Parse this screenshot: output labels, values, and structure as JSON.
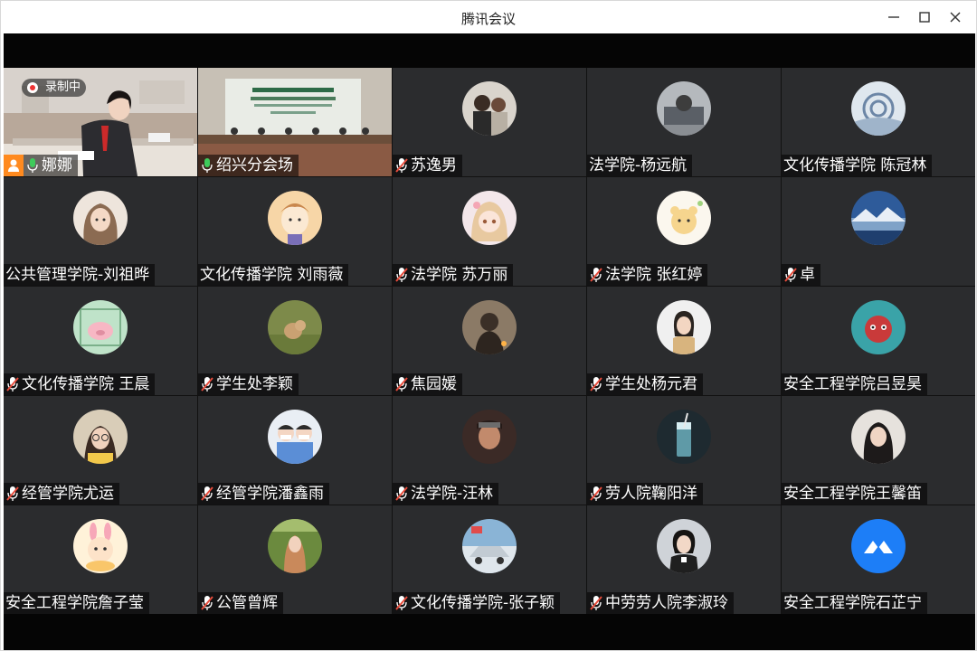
{
  "window": {
    "title": "腾讯会议",
    "controls": [
      "minimize",
      "maximize",
      "close"
    ]
  },
  "recording": {
    "label": "录制中"
  },
  "participants": [
    {
      "name": "娜娜",
      "mic": "on",
      "video": "speaker",
      "host": true,
      "active": true
    },
    {
      "name": "绍兴分会场",
      "mic": "on",
      "video": "room"
    },
    {
      "name": "苏逸男",
      "mic": "muted",
      "avatar": "photo-couple"
    },
    {
      "name": "法学院-杨远航",
      "mic": "none",
      "avatar": "photo-room"
    },
    {
      "name": "文化传播学院 陈冠林",
      "mic": "none",
      "avatar": "photo-pattern"
    },
    {
      "name": "公共管理学院-刘祖晔",
      "mic": "none",
      "avatar": "anime-girl"
    },
    {
      "name": "文化传播学院 刘雨薇",
      "mic": "none",
      "avatar": "cartoon-face"
    },
    {
      "name": "法学院 苏万丽",
      "mic": "muted",
      "avatar": "anime-cute"
    },
    {
      "name": "法学院 张红婷",
      "mic": "muted",
      "avatar": "cartoon-bear"
    },
    {
      "name": "卓",
      "mic": "muted",
      "avatar": "landscape"
    },
    {
      "name": "文化传播学院 王晨",
      "mic": "muted",
      "avatar": "cartoon-pig"
    },
    {
      "name": "学生处李颖",
      "mic": "muted",
      "avatar": "photo-dog"
    },
    {
      "name": "焦园媛",
      "mic": "muted",
      "avatar": "photo-silhouette"
    },
    {
      "name": "学生处杨元君",
      "mic": "muted",
      "avatar": "photo-woman"
    },
    {
      "name": "安全工程学院吕昱昊",
      "mic": "none",
      "avatar": "cartoon-red"
    },
    {
      "name": "经管学院尤运",
      "mic": "muted",
      "avatar": "photo-glasses"
    },
    {
      "name": "经管学院潘鑫雨",
      "mic": "muted",
      "avatar": "cartoon-doctors"
    },
    {
      "name": "法学院-汪林",
      "mic": "muted",
      "avatar": "photo-man"
    },
    {
      "name": "劳人院鞠阳洋",
      "mic": "muted",
      "avatar": "photo-drink"
    },
    {
      "name": "安全工程学院王馨笛",
      "mic": "none",
      "avatar": "photo-girl"
    },
    {
      "name": "安全工程学院詹子莹",
      "mic": "none",
      "avatar": "cartoon-rabbit"
    },
    {
      "name": "公管曾辉",
      "mic": "muted",
      "avatar": "photo-outdoor"
    },
    {
      "name": "文化传播学院-张子颖",
      "mic": "muted",
      "avatar": "photo-car"
    },
    {
      "name": "中劳劳人院李淑玲",
      "mic": "muted",
      "avatar": "photo-lady"
    },
    {
      "name": "安全工程学院石芷宁",
      "mic": "none",
      "avatar": "tencent-logo"
    }
  ],
  "colors": {
    "tile_bg": "#2b2c2e",
    "mic_on": "#3ecb5b",
    "mic_muted": "#e74c3c",
    "host_badge": "#ff8a1f",
    "active_border": "#5fd17b",
    "logo_blue": "#1d7ef7"
  }
}
